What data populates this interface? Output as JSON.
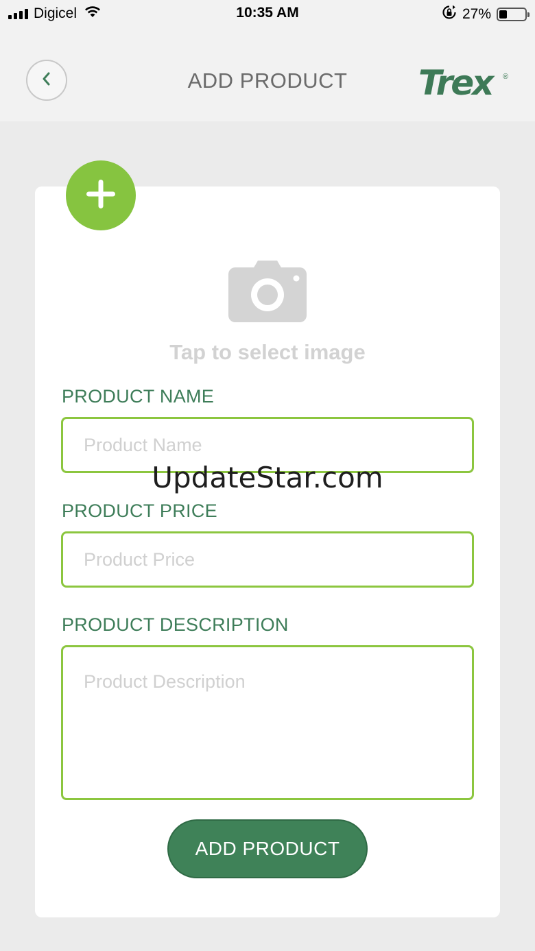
{
  "status_bar": {
    "carrier": "Digicel",
    "time": "10:35 AM",
    "battery_percent": "27%",
    "battery_level": 0.27,
    "icons": [
      "signal-icon",
      "wifi-icon",
      "rotation-lock-icon",
      "battery-icon"
    ]
  },
  "header": {
    "title": "ADD PRODUCT",
    "logo_text": "Trex",
    "logo_mark": "®",
    "back_icon": "chevron-left-icon"
  },
  "image_picker": {
    "add_icon": "plus-icon",
    "camera_icon": "camera-icon",
    "hint": "Tap to select image"
  },
  "form": {
    "name_label": "PRODUCT NAME",
    "name_placeholder": "Product Name",
    "name_value": "",
    "price_label": "PRODUCT PRICE",
    "price_placeholder": "Product Price",
    "price_value": "",
    "description_label": "PRODUCT DESCRIPTION",
    "description_placeholder": "Product Description",
    "description_value": "",
    "submit_label": "ADD PRODUCT"
  },
  "watermark": "UpdateStar.com",
  "colors": {
    "brand_green": "#3e7d59",
    "accent_green": "#86c440",
    "field_border": "#8cc63f",
    "button_bg": "#3f8258"
  }
}
